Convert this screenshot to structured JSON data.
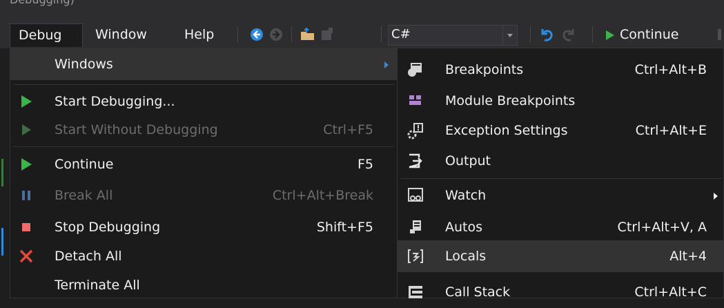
{
  "title_fragment": "Debugging)",
  "menubar": {
    "items": [
      "Debug",
      "Window",
      "Help"
    ],
    "language": "C#",
    "continue_label": "Continue"
  },
  "debug_menu": {
    "items": [
      {
        "label": "Windows",
        "shortcut": "",
        "submenu": true,
        "state": "highlighted"
      },
      {
        "label": "Start Debugging...",
        "shortcut": "",
        "icon": "play-icon",
        "state": "enabled"
      },
      {
        "label": "Start Without Debugging",
        "shortcut": "Ctrl+F5",
        "icon": "play-outline-icon",
        "state": "disabled"
      },
      {
        "label": "Continue",
        "shortcut": "F5",
        "icon": "play-icon",
        "state": "enabled"
      },
      {
        "label": "Break All",
        "shortcut": "Ctrl+Alt+Break",
        "icon": "pause-icon",
        "state": "disabled"
      },
      {
        "label": "Stop Debugging",
        "shortcut": "Shift+F5",
        "icon": "stop-icon",
        "state": "enabled"
      },
      {
        "label": "Detach All",
        "shortcut": "",
        "icon": "detach-x-icon",
        "state": "enabled"
      },
      {
        "label": "Terminate All",
        "shortcut": "",
        "state": "enabled"
      }
    ]
  },
  "windows_submenu": {
    "items": [
      {
        "label": "Breakpoints",
        "shortcut": "Ctrl+Alt+B",
        "icon": "breakpoints-icon"
      },
      {
        "label": "Module Breakpoints",
        "shortcut": "",
        "icon": "module-breakpoints-icon"
      },
      {
        "label": "Exception Settings",
        "shortcut": "Ctrl+Alt+E",
        "icon": "exception-settings-icon"
      },
      {
        "label": "Output",
        "shortcut": "",
        "icon": "output-icon"
      },
      {
        "label": "Watch",
        "shortcut": "",
        "icon": "watch-icon",
        "submenu": true
      },
      {
        "label": "Autos",
        "shortcut": "Ctrl+Alt+V, A",
        "icon": "autos-icon"
      },
      {
        "label": "Locals",
        "shortcut": "Alt+4",
        "icon": "locals-icon",
        "state": "highlighted"
      },
      {
        "label": "Call Stack",
        "shortcut": "Ctrl+Alt+C",
        "icon": "call-stack-icon"
      }
    ]
  },
  "colors": {
    "play": "#3bb44a",
    "stop": "#f06c6c",
    "detach": "#e8483c",
    "nav_blue": "#2d8be0",
    "module_purple": "#b180d7"
  }
}
